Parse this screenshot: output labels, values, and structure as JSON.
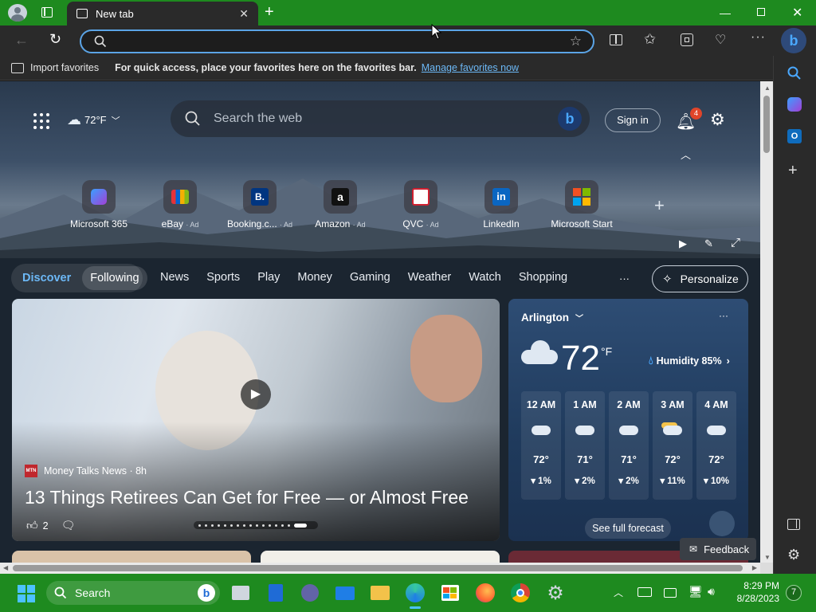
{
  "browser": {
    "tab_title": "New tab",
    "address_value": "",
    "favorites_bar": {
      "import_label": "Import favorites",
      "message": "For quick access, place your favorites here on the favorites bar.",
      "manage_link": "Manage favorites now"
    }
  },
  "newtab": {
    "weather_chip": "72°F",
    "search_placeholder": "Search the web",
    "sign_in": "Sign in",
    "notif_count": "4",
    "quick_links": [
      {
        "label": "Microsoft 365",
        "ad": ""
      },
      {
        "label": "eBay",
        "ad": "· Ad"
      },
      {
        "label": "Booking.c...",
        "ad": "· Ad"
      },
      {
        "label": "Amazon",
        "ad": "· Ad"
      },
      {
        "label": "QVC",
        "ad": "· Ad"
      },
      {
        "label": "LinkedIn",
        "ad": ""
      },
      {
        "label": "Microsoft Start",
        "ad": ""
      }
    ],
    "tabs": [
      "Discover",
      "Following"
    ],
    "nav": [
      "News",
      "Sports",
      "Play",
      "Money",
      "Gaming",
      "Weather",
      "Watch",
      "Shopping"
    ],
    "more": "···",
    "personalize": "Personalize"
  },
  "hero_article": {
    "source_logo": "MTN",
    "source": "Money Talks News · 8h",
    "headline": "13 Things Retirees Can Get for Free — or Almost Free",
    "likes": "2"
  },
  "weather": {
    "location": "Arlington",
    "temp": "72",
    "unit": "°F",
    "humidity": "Humidity 85%",
    "more": "···",
    "hourly": [
      {
        "time": "12 AM",
        "temp": "72°",
        "precip": "1%"
      },
      {
        "time": "1 AM",
        "temp": "71°",
        "precip": "2%"
      },
      {
        "time": "2 AM",
        "temp": "71°",
        "precip": "2%"
      },
      {
        "time": "3 AM",
        "temp": "72°",
        "precip": "11%"
      },
      {
        "time": "4 AM",
        "temp": "72°",
        "precip": "10%"
      }
    ],
    "forecast_button": "See full forecast"
  },
  "feedback": "Feedback",
  "taskbar": {
    "search": "Search",
    "time": "8:29 PM",
    "date": "8/28/2023",
    "badge": "7"
  },
  "colors": {
    "accent_green": "#1e8a1f",
    "link_blue": "#6cb8f6",
    "address_border": "#5ba4e6",
    "notif_badge": "#e0452a"
  }
}
